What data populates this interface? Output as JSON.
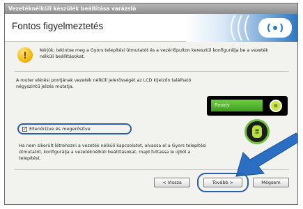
{
  "window": {
    "title": "Vezetéknélküli készülék beállítása varázsló"
  },
  "header": {
    "title": "Fontos figyelmeztetés"
  },
  "warning": {
    "icon": "exclamation-icon",
    "text": "Kérjük, tekintse meg a Gyors telepítési útmutatót és a vezérlőpulton keresztül konfigurálja be a vezeték nélküli beállításokat."
  },
  "router_note": {
    "text": "A router elérési pontjának vezeték nélküli jelerősségét az LCD kijelzőn található négyszintű jelzés mutatja."
  },
  "lcd": {
    "status": "Ready"
  },
  "confirm": {
    "label": "Ellenőrizve és megerősítve",
    "checked": true
  },
  "info": {
    "text": "Ha nem sikerült létrehozni a vezeték nélküli kapcsolatot, olvassa el a Gyors telepítési útmutatót, konfigurálja a vezetéknélküli beállításokat, majd futtassa le újból a telepítést."
  },
  "buttons": {
    "back": "< Vissza",
    "next": "Tovább >",
    "cancel": "Mégsem"
  },
  "colors": {
    "accent_blue": "#2a5fa8",
    "lcd_green": "#4fb52a"
  }
}
